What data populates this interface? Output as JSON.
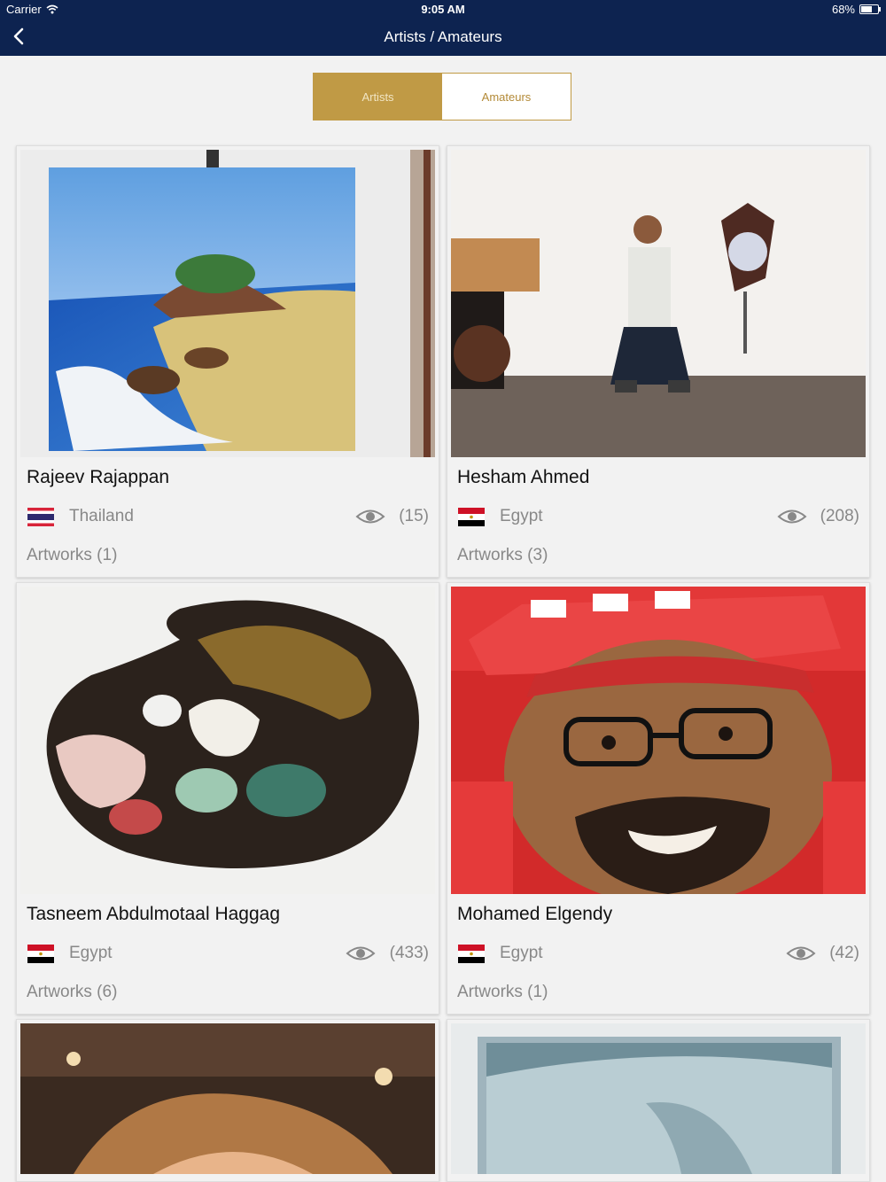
{
  "status_bar": {
    "carrier": "Carrier",
    "time": "9:05 AM",
    "battery": "68%"
  },
  "nav": {
    "title": "Artists / Amateurs"
  },
  "segment": {
    "artists": "Artists",
    "amateurs": "Amateurs",
    "selected": "Artists"
  },
  "artists": [
    {
      "name": "Rajeev Rajappan",
      "country": "Thailand",
      "flag": "thailand-flag",
      "views": "(15)",
      "artworks": "Artworks (1)",
      "photo": "seascape-painting"
    },
    {
      "name": "Hesham Ahmed",
      "country": "Egypt",
      "flag": "egypt-flag",
      "views": "(208)",
      "artworks": "Artworks (3)",
      "photo": "man-crouching-in-gallery"
    },
    {
      "name": "Tasneem Abdulmotaal Haggag",
      "country": "Egypt",
      "flag": "egypt-flag",
      "views": "(433)",
      "artworks": "Artworks (6)",
      "photo": "paint-palette"
    },
    {
      "name": "Mohamed Elgendy",
      "country": "Egypt",
      "flag": "egypt-flag",
      "views": "(42)",
      "artworks": "Artworks (1)",
      "photo": "man-in-red-cap-portrait"
    }
  ],
  "colors": {
    "navbar": "#0d2350",
    "accent_gold": "#c09a45",
    "background": "#f2f2f2"
  }
}
